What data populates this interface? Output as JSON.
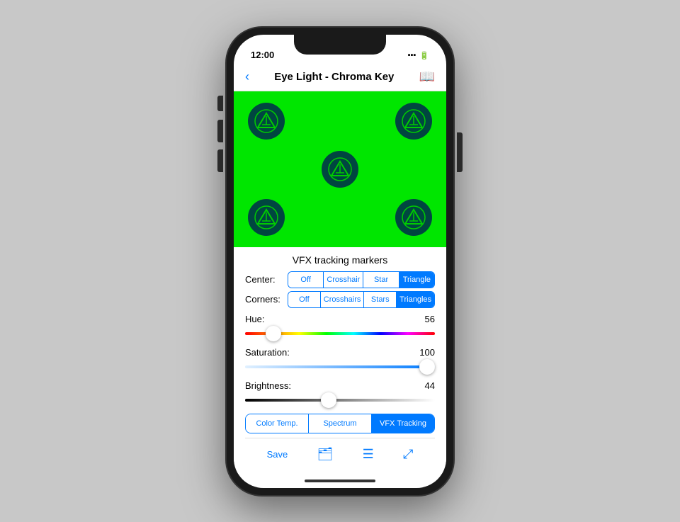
{
  "statusBar": {
    "time": "12:00",
    "wifi": "wifi",
    "battery": "battery"
  },
  "navBar": {
    "title": "Eye Light - Chroma Key",
    "backIcon": "‹",
    "bookIcon": "📖"
  },
  "greenArea": {
    "label": "VFX green screen display"
  },
  "controls": {
    "sectionTitle": "VFX tracking markers",
    "center": {
      "label": "Center:",
      "options": [
        "Off",
        "Crosshair",
        "Star",
        "Triangle"
      ],
      "activeIndex": 3
    },
    "corners": {
      "label": "Corners:",
      "options": [
        "Off",
        "Crosshairs",
        "Stars",
        "Triangles"
      ],
      "activeIndex": 3
    },
    "hue": {
      "label": "Hue:",
      "value": "56",
      "thumbPercent": 15
    },
    "saturation": {
      "label": "Saturation:",
      "value": "100",
      "thumbPercent": 96
    },
    "brightness": {
      "label": "Brightness:",
      "value": "44",
      "thumbPercent": 44
    }
  },
  "bottomTabs": {
    "options": [
      "Color Temp.",
      "Spectrum",
      "VFX Tracking"
    ],
    "activeIndex": 2
  },
  "footer": {
    "save": "Save",
    "folderIcon": "🗂",
    "listIcon": "☰",
    "expandIcon": "⤢"
  }
}
